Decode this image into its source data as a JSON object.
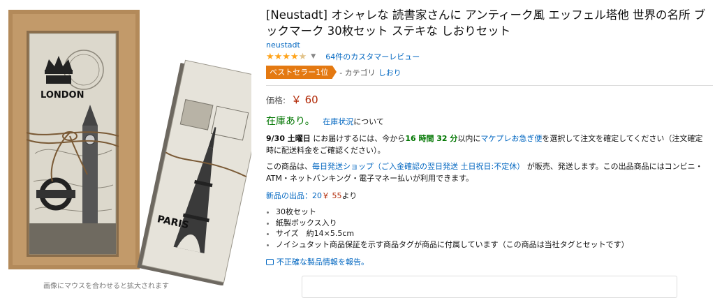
{
  "product": {
    "title": "[Neustadt] オシャレな 読書家さんに アンティーク風 エッフェル塔他 世界の名所 ブックマーク 30枚セット ステキな しおりセット",
    "brand": "neustadt",
    "rating_stars": 4.5,
    "reviews_label": "64件のカスタマーレビュー",
    "bestseller_badge": "ベストセラー1位",
    "category_prefix": "- カテゴリ",
    "category_link": "しおり",
    "price_label": "価格:",
    "price": "￥ 60",
    "stock": "在庫あり。",
    "stock_status_link": "在庫状況",
    "stock_status_suffix": "について",
    "delivery": {
      "date": "9/30 土曜日",
      "text1": "にお届けするには、今から",
      "hours": "16 時間 32 分",
      "text2": "以内に",
      "express_link": "マケプレお急ぎ便",
      "text3": "を選択して注文を確定してください（注文確定時に配送料金をご確認ください）。"
    },
    "seller": {
      "prefix": "この商品は、",
      "shop_link": "毎日発送ショップ（ご入金確認の翌日発送 土日祝日:不定休）",
      "suffix": "が販売、発送します。この出品商品にはコンビニ・ATM・ネットバンキング・電子マネー払いが利用できます。"
    },
    "offers": {
      "label": "新品の出品：20",
      "price": "￥ 55",
      "suffix": "より"
    },
    "bullets": [
      "30枚セット",
      "紙製ボックス入り",
      "サイズ　約14×5.5cm",
      "ノイシュタット商品保証を示す商品タグが商品に付属しています（この商品は当社タグとセットです）"
    ],
    "report_link": "不正確な製品情報を報告。"
  },
  "image": {
    "card1_city": "LONDON",
    "card2_city": "PARIS",
    "caption": "画像にマウスを合わせると拡大されます"
  },
  "colors": {
    "price": "#b12704",
    "stock": "#007600",
    "link": "#0066c0",
    "badge": "#e47911",
    "stars": "#ffa41c"
  }
}
